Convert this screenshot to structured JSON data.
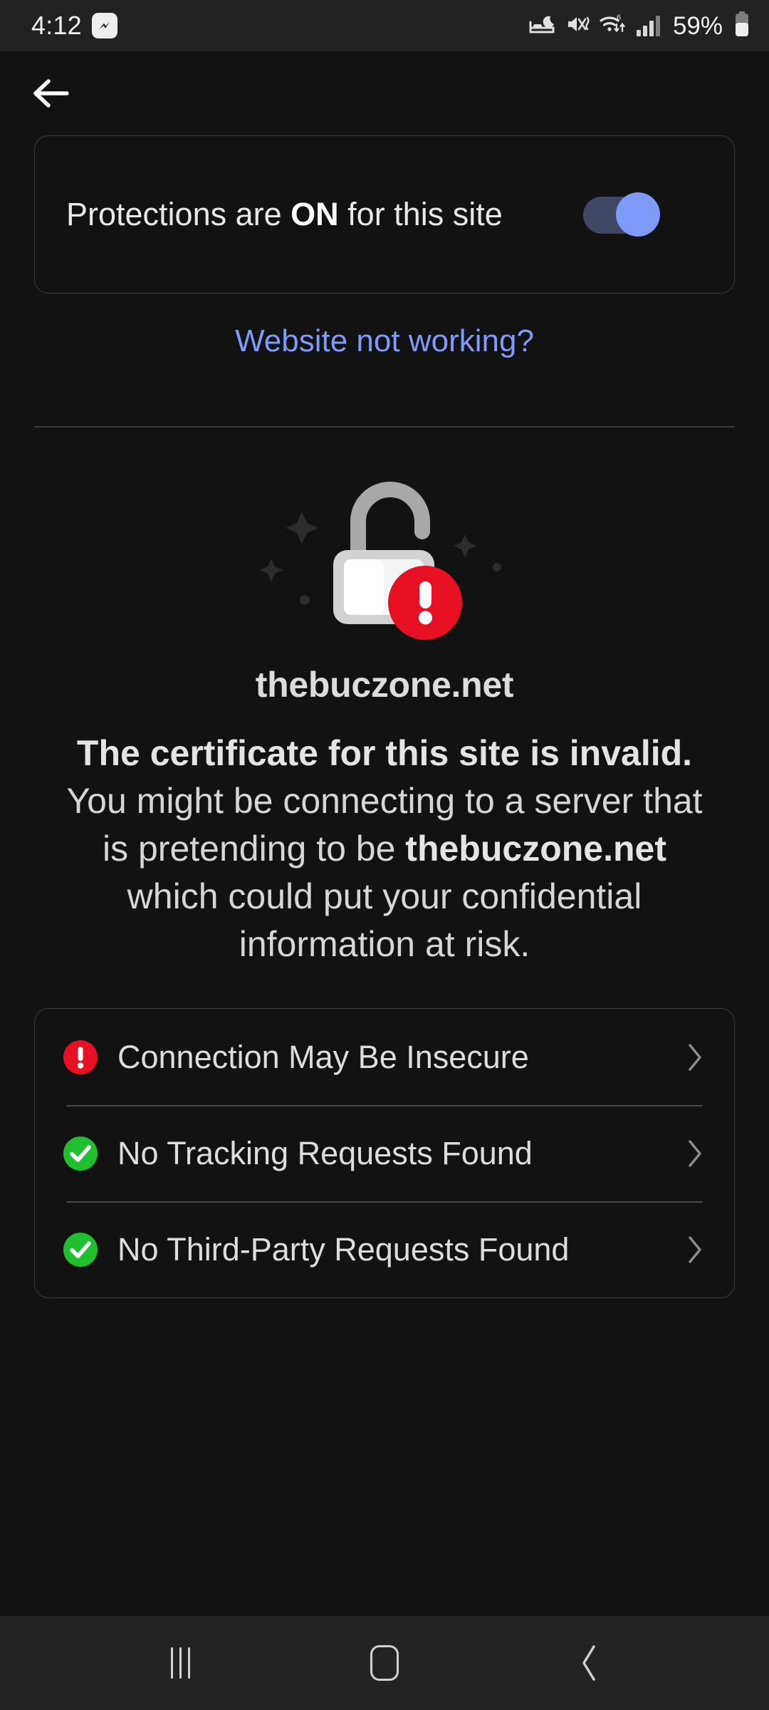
{
  "status_bar": {
    "time": "4:12",
    "notification_icon": "messenger-app-icon",
    "icons": [
      "bedtime-icon",
      "mute-vibrate-icon",
      "wifi-6-icon",
      "signal-bars-icon"
    ],
    "wifi_generation": "6",
    "battery_percent": "59%",
    "battery_icon": "battery-icon"
  },
  "topbar": {
    "back_icon": "arrow-left-icon"
  },
  "protections": {
    "label_prefix": "Protections are ",
    "label_state": "ON",
    "label_suffix": " for this site",
    "toggle_state": "on",
    "toggle_accent": "#7f9bfa",
    "not_working_link": "Website not working?"
  },
  "warning": {
    "illustration": "unlocked-padlock-with-error-badge",
    "site_name": "thebuczone.net",
    "body_bold_1": "The certificate for this site is invalid.",
    "body_mid": " You might be connecting to a server that is pretending to be ",
    "body_bold_2": "thebuczone.net",
    "body_end": " which could put your confidential information at risk.",
    "error_color": "#e81123",
    "ok_color": "#1fbf2e"
  },
  "details": {
    "rows": [
      {
        "label": "Connection May Be Insecure",
        "status": "error",
        "icon": "error-exclamation-icon",
        "chevron": "chevron-right-icon"
      },
      {
        "label": "No Tracking Requests Found",
        "status": "ok",
        "icon": "check-circle-icon",
        "chevron": "chevron-right-icon"
      },
      {
        "label": "No Third-Party Requests Found",
        "status": "ok",
        "icon": "check-circle-icon",
        "chevron": "chevron-right-icon"
      }
    ]
  },
  "navbar": {
    "recents": "recents-icon",
    "home": "home-icon",
    "back": "back-chevron-icon"
  }
}
